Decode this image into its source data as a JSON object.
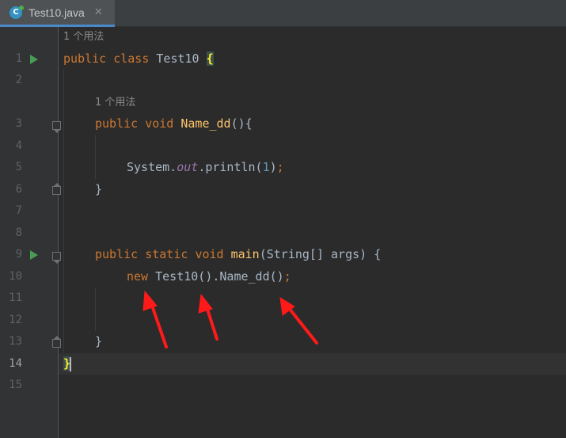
{
  "tab": {
    "icon_letter": "C",
    "filename": "Test10.java",
    "close_glyph": "✕"
  },
  "hints": {
    "class_usage": "1 个用法",
    "method_usage": "1 个用法"
  },
  "line_numbers": [
    "1",
    "2",
    "3",
    "4",
    "5",
    "6",
    "7",
    "8",
    "9",
    "10",
    "11",
    "12",
    "13",
    "14",
    "15"
  ],
  "current_line": "14",
  "code": {
    "l1": {
      "kw1": "public",
      "kw2": "class",
      "name": "Test10",
      "brace": "{"
    },
    "l3": {
      "kw1": "public",
      "kw2": "void",
      "name": "Name_dd",
      "rest": "(){"
    },
    "l5": {
      "obj": "System.",
      "field": "out",
      "call": ".println(",
      "num": "1",
      "close": ")",
      "semi": ";"
    },
    "l6": {
      "text": "}"
    },
    "l9": {
      "kw1": "public",
      "kw2": "static",
      "kw3": "void",
      "name": "main",
      "rest": "(String[] args) {"
    },
    "l10": {
      "kw": "new",
      "rest": "Test10().Name_dd()",
      "semi": ";"
    },
    "l13": {
      "text": "}"
    },
    "l14": {
      "text": "}"
    }
  },
  "colors": {
    "keyword": "#cc7832",
    "method_declaration": "#ffc66d",
    "annotation_arrow": "#ff1a1a",
    "run_icon": "#499c54"
  },
  "icons": [
    "java-class-icon",
    "close-icon",
    "run-icon",
    "fold-icon"
  ]
}
